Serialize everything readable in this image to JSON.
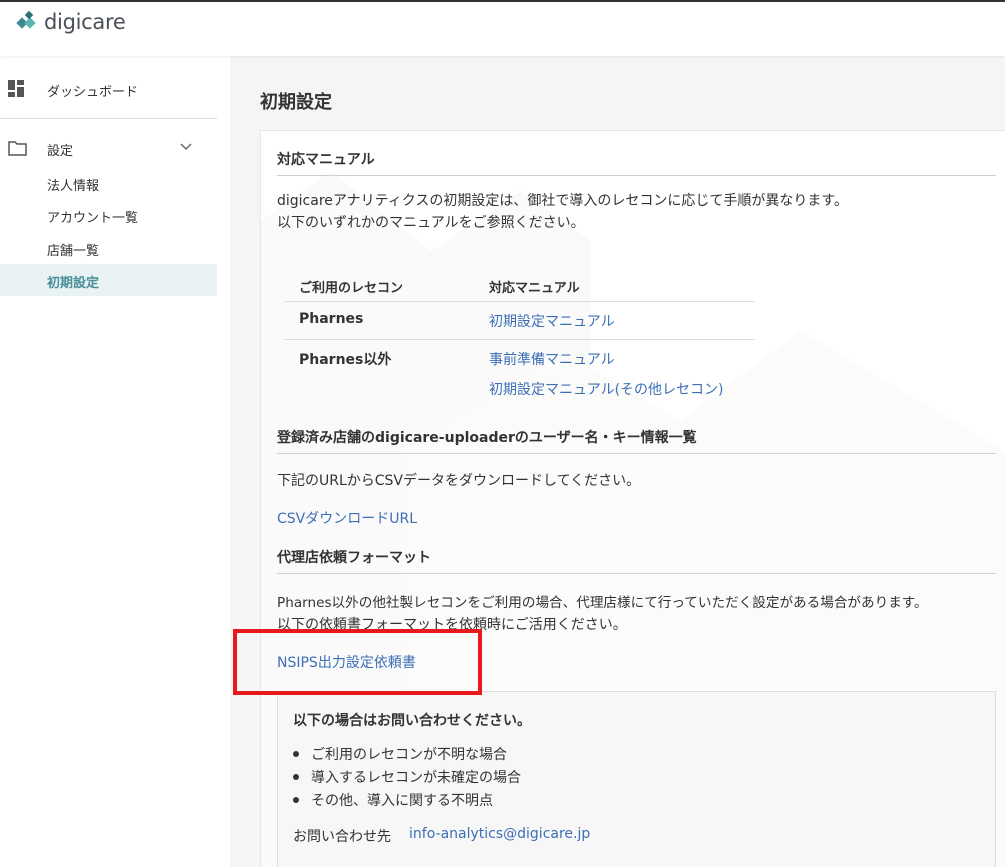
{
  "app": {
    "brand": "digicare"
  },
  "sidebar": {
    "dashboard": "ダッシュボード",
    "settings": "設定",
    "sub_items": [
      "法人情報",
      "アカウント一覧",
      "店舗一覧"
    ],
    "active_item": "初期設定"
  },
  "page": {
    "title": "初期設定"
  },
  "manual_section": {
    "title": "対応マニュアル",
    "intro_line1": "digicareアナリティクスの初期設定は、御社で導入のレセコンに応じて手順が異なります。",
    "intro_line2": "以下のいずれかのマニュアルをご参照ください。",
    "table": {
      "headers": [
        "ご利用のレセコン",
        "対応マニュアル"
      ],
      "rows": [
        {
          "recekon": "Pharnes",
          "links": [
            "初期設定マニュアル"
          ]
        },
        {
          "recekon": "Pharnes以外",
          "links": [
            "事前準備マニュアル",
            "初期設定マニュアル(その他レセコン)"
          ]
        }
      ]
    }
  },
  "uploader_section": {
    "title": "登録済み店舗のdigicare-uploaderのユーザー名・キー情報一覧",
    "text": "下記のURLからCSVデータをダウンロードしてください。",
    "link": "CSVダウンロードURL"
  },
  "agency_section": {
    "title": "代理店依頼フォーマット",
    "line1": "Pharnes以外の他社製レセコンをご利用の場合、代理店様にて行っていただく設定がある場合があります。",
    "line2": "以下の依頼書フォーマットを依頼時にご活用ください。",
    "link": "NSIPS出力設定依頼書"
  },
  "contact_box": {
    "title": "以下の場合はお問い合わせください。",
    "items": [
      "ご利用のレセコンが不明な場合",
      "導入するレセコンが未確定の場合",
      "その他、導入に関する不明点"
    ],
    "label": "お問い合わせ先",
    "email": "info-analytics@digicare.jp"
  },
  "colors": {
    "brand": "#4a8e99",
    "link": "#3d6fb5",
    "highlight": "#e8181d"
  }
}
